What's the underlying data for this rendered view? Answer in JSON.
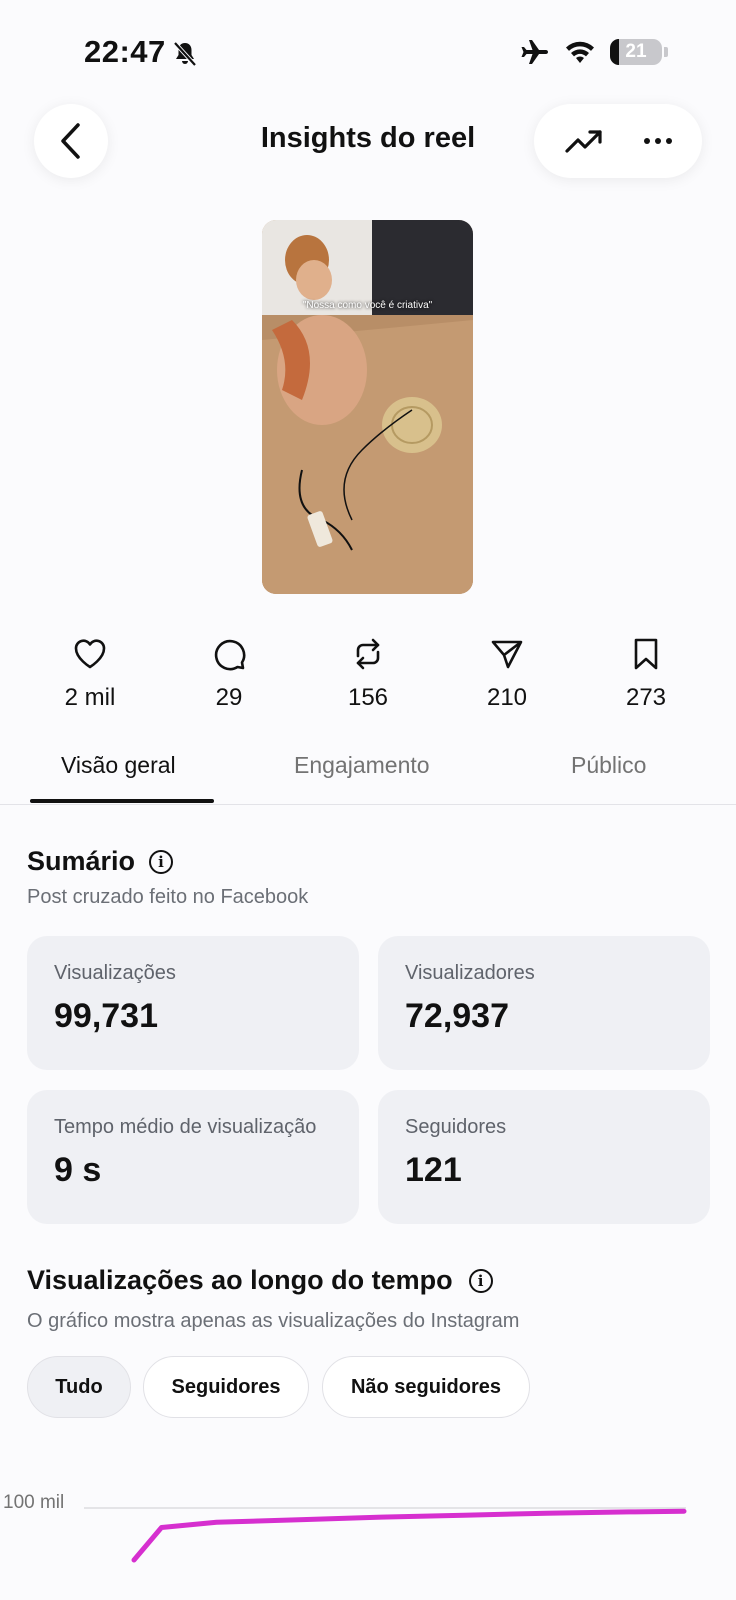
{
  "status_bar": {
    "time": "22:47",
    "battery": "21"
  },
  "header": {
    "title": "Insights do reel"
  },
  "reel": {
    "caption": "\"Nossa como você é criativa\""
  },
  "stats": [
    {
      "icon": "heart-icon",
      "value": "2 mil"
    },
    {
      "icon": "comment-icon",
      "value": "29"
    },
    {
      "icon": "repost-icon",
      "value": "156"
    },
    {
      "icon": "share-icon",
      "value": "210"
    },
    {
      "icon": "save-icon",
      "value": "273"
    }
  ],
  "tabs": [
    "Visão geral",
    "Engajamento",
    "Público"
  ],
  "summary": {
    "title": "Sumário",
    "subtitle": "Post cruzado feito no Facebook",
    "cards": [
      {
        "label": "Visualizações",
        "value": "99,731"
      },
      {
        "label": "Visualizadores",
        "value": "72,937"
      },
      {
        "label": "Tempo médio de visualização",
        "value": "9 s"
      },
      {
        "label": "Seguidores",
        "value": "121"
      }
    ]
  },
  "views_over_time": {
    "title": "Visualizações ao longo do tempo",
    "subtitle": "O gráfico mostra apenas as visualizações do Instagram",
    "filters": [
      "Tudo",
      "Seguidores",
      "Não seguidores"
    ],
    "selected_filter": "Tudo"
  },
  "chart_data": {
    "type": "line",
    "tick_labels_y": [
      "100 mil"
    ],
    "series": [
      {
        "color": "#d62fcf",
        "points": [
          [
            0,
            60
          ],
          [
            0.05,
            85
          ],
          [
            0.15,
            89
          ],
          [
            0.3,
            91
          ],
          [
            0.45,
            93
          ],
          [
            0.6,
            94.5
          ],
          [
            0.75,
            96
          ],
          [
            0.9,
            97
          ],
          [
            1,
            97.5
          ]
        ]
      }
    ],
    "ylim": [
      0,
      100
    ]
  }
}
